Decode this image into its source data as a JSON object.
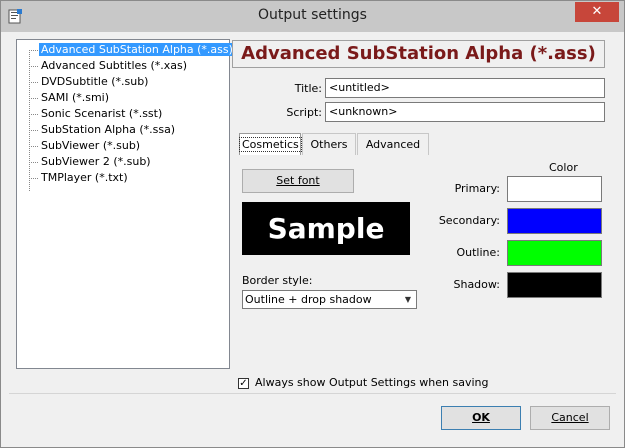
{
  "window": {
    "title": "Output settings",
    "close_label": "✕"
  },
  "formats": [
    "Advanced SubStation Alpha (*.ass)",
    "Advanced Subtitles (*.xas)",
    "DVDSubtitle (*.sub)",
    "SAMI (*.smi)",
    "Sonic Scenarist (*.sst)",
    "SubStation Alpha (*.ssa)",
    "SubViewer (*.sub)",
    "SubViewer 2 (*.sub)",
    "TMPlayer (*.txt)"
  ],
  "selected_format": "Advanced SubStation Alpha (*.ass)",
  "fields": {
    "title_label": "Title:",
    "title_value": "<untitled>",
    "script_label": "Script:",
    "script_value": "<unknown>"
  },
  "tabs": [
    "Cosmetics",
    "Others",
    "Advanced"
  ],
  "cosmetics": {
    "set_font_label": "Set font",
    "sample_text": "Sample",
    "border_style_label": "Border style:",
    "border_style_value": "Outline + drop shadow",
    "color_heading": "Color",
    "colors": [
      {
        "label": "Primary:",
        "hex": "#ffffff"
      },
      {
        "label": "Secondary:",
        "hex": "#0000ff"
      },
      {
        "label": "Outline:",
        "hex": "#00ff00"
      },
      {
        "label": "Shadow:",
        "hex": "#000000"
      }
    ]
  },
  "always_show_label": "Always show Output Settings when saving",
  "always_show_checked": true,
  "buttons": {
    "ok": "OK",
    "cancel": "Cancel"
  }
}
